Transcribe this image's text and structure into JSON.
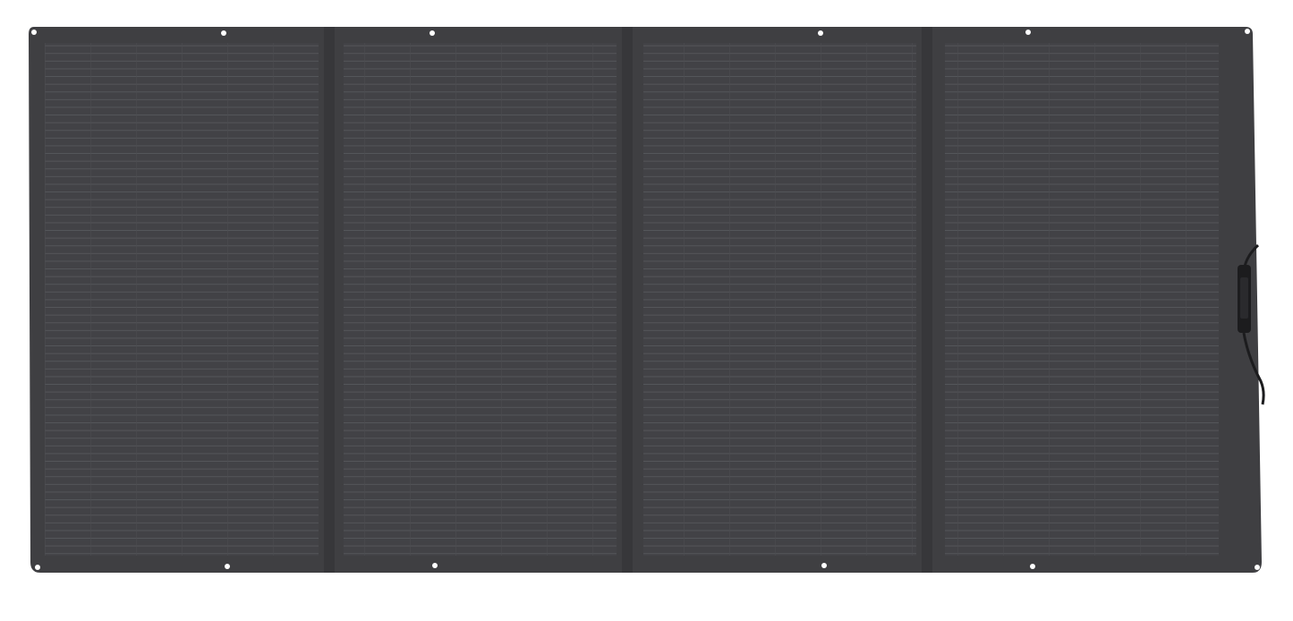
{
  "image": {
    "subject": "foldable-solar-panel",
    "background_color": "#ffffff",
    "panel_color": "#3f3f42",
    "cell_line_color": "#55565a",
    "grommet_color": "#ffffff",
    "connector_color": "#1c1c1e",
    "panel_count": 4
  }
}
